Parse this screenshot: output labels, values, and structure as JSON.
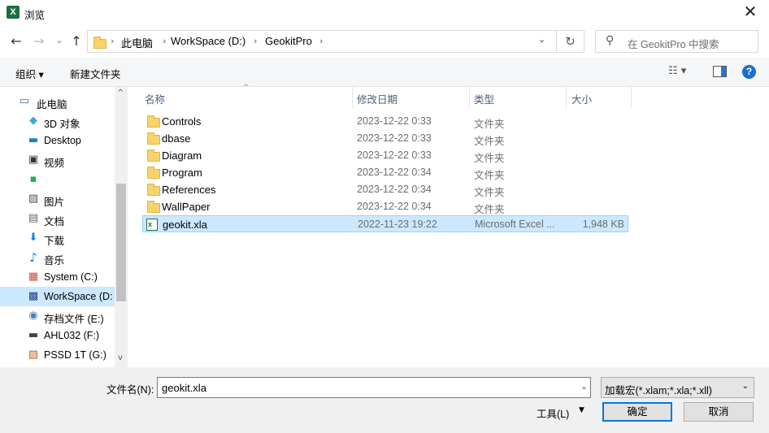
{
  "window": {
    "title": "浏览",
    "app_icon": "excel-icon",
    "close_glyph": "✕"
  },
  "nav": {
    "back_glyph": "←",
    "forward_glyph": "→",
    "recent_glyph": "⌄",
    "up_glyph": "↑",
    "breadcrumbs": [
      "此电脑",
      "WorkSpace (D:)",
      "GeokitPro"
    ],
    "crumb_sep": "›",
    "refresh_glyph": "↻",
    "search_placeholder": "在 GeokitPro 中搜索"
  },
  "toolbar": {
    "organize": "组织 ▾",
    "new_folder": "新建文件夹",
    "help": "?"
  },
  "sidebar": {
    "items": [
      {
        "label": "此电脑",
        "icon": "computer-icon",
        "glyph": "▭"
      },
      {
        "label": "3D 对象",
        "icon": "3d-objects-icon",
        "glyph": "◆"
      },
      {
        "label": "Desktop",
        "icon": "desktop-icon",
        "glyph": "▬"
      },
      {
        "label": "视频",
        "icon": "video-icon",
        "glyph": "▣"
      },
      {
        "label": "",
        "icon": "iqiyi-icon",
        "glyph": "▪"
      },
      {
        "label": "图片",
        "icon": "pictures-icon",
        "glyph": "▨"
      },
      {
        "label": "文档",
        "icon": "documents-icon",
        "glyph": "▤"
      },
      {
        "label": "下载",
        "icon": "download-icon",
        "glyph": "⬇"
      },
      {
        "label": "音乐",
        "icon": "music-icon",
        "glyph": "♪"
      },
      {
        "label": "System (C:)",
        "icon": "system-drive-icon",
        "glyph": "▦"
      },
      {
        "label": "WorkSpace (D:",
        "icon": "workspace-drive-icon",
        "glyph": "▩"
      },
      {
        "label": "存档文件 (E:)",
        "icon": "archive-drive-icon",
        "glyph": "◉"
      },
      {
        "label": "AHL032 (F:)",
        "icon": "usb-drive-icon",
        "glyph": "▬"
      },
      {
        "label": "PSSD 1T (G:)",
        "icon": "pssd-drive-icon",
        "glyph": "▧"
      }
    ],
    "scroll_up": "^",
    "scroll_down": "v"
  },
  "columns": {
    "name": "名称",
    "date": "修改日期",
    "type": "类型",
    "size": "大小",
    "sort_glyph": "^"
  },
  "files": [
    {
      "name": "Controls",
      "date": "2023-12-22 0:33",
      "type": "文件夹",
      "size": ""
    },
    {
      "name": "dbase",
      "date": "2023-12-22 0:33",
      "type": "文件夹",
      "size": ""
    },
    {
      "name": "Diagram",
      "date": "2023-12-22 0:33",
      "type": "文件夹",
      "size": ""
    },
    {
      "name": "Program",
      "date": "2023-12-22 0:34",
      "type": "文件夹",
      "size": ""
    },
    {
      "name": "References",
      "date": "2023-12-22 0:34",
      "type": "文件夹",
      "size": ""
    },
    {
      "name": "WallPaper",
      "date": "2023-12-22 0:34",
      "type": "文件夹",
      "size": ""
    },
    {
      "name": "geokit.xla",
      "date": "2022-11-23 19:22",
      "type": "Microsoft Excel ...",
      "size": "1,948 KB"
    }
  ],
  "bottom": {
    "filename_label": "文件名(N):",
    "filename_value": "geokit.xla",
    "filter_value": "加载宏(*.xlam;*.xla;*.xll)",
    "tools_label": "工具(L)",
    "ok_label": "确定",
    "cancel_label": "取消"
  },
  "colors": {
    "selection": "#cce8ff",
    "accent": "#0078d7",
    "folder": "#f6d46b"
  }
}
